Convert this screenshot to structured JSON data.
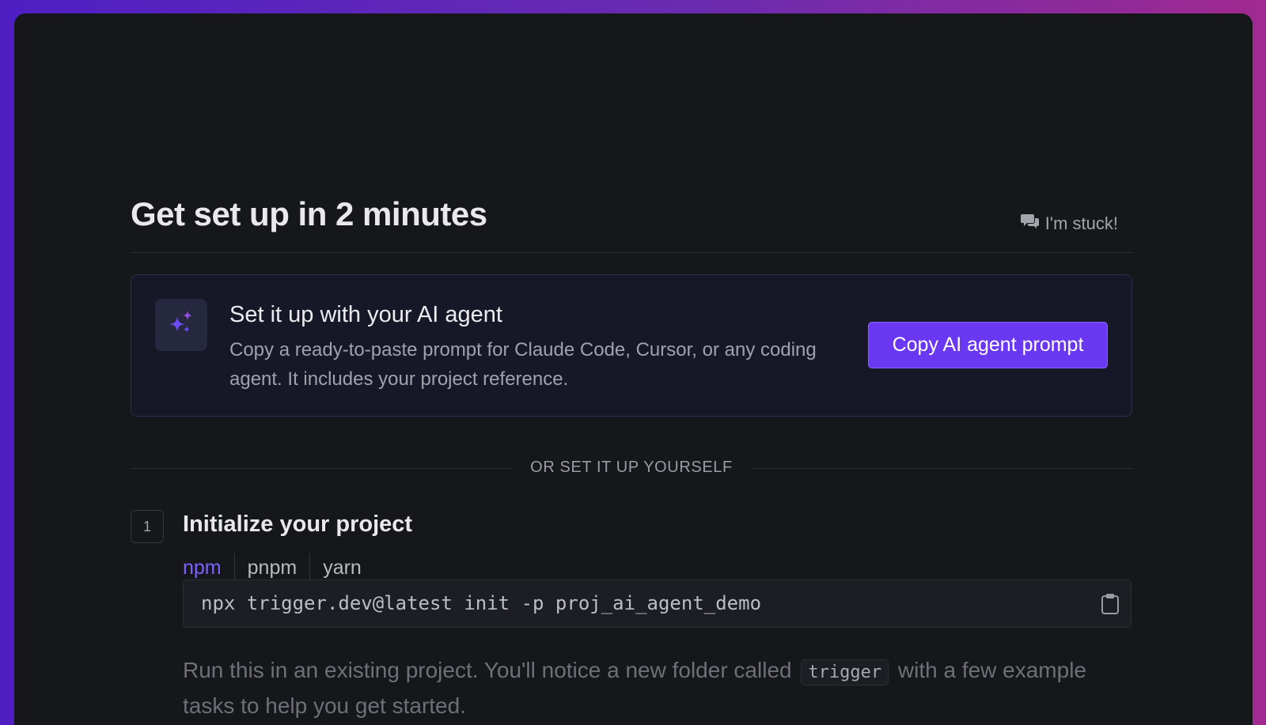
{
  "header": {
    "title": "Get set up in 2 minutes",
    "stuck_label": "I'm stuck!",
    "stuck_icon": "chat-bubbles-icon"
  },
  "ai_card": {
    "icon": "sparkles-icon",
    "title": "Set it up with your AI agent",
    "description": "Copy a ready-to-paste prompt for Claude Code, Cursor, or any coding agent. It includes your project reference.",
    "button_label": "Copy AI agent prompt"
  },
  "divider": {
    "label": "OR SET IT UP YOURSELF"
  },
  "step1": {
    "number": "1",
    "title": "Initialize your project",
    "tabs": [
      "npm",
      "pnpm",
      "yarn"
    ],
    "active_tab": "npm",
    "command": "npx trigger.dev@latest init -p proj_ai_agent_demo",
    "copy_icon": "clipboard-icon",
    "help_before": "Run this in an existing project. You'll notice a new folder called",
    "help_code": "trigger",
    "help_after": "with a few example tasks to help you get started."
  },
  "colors": {
    "accent": "#6a38f2",
    "active_tab": "#7b63ff",
    "background": "#16171b"
  }
}
